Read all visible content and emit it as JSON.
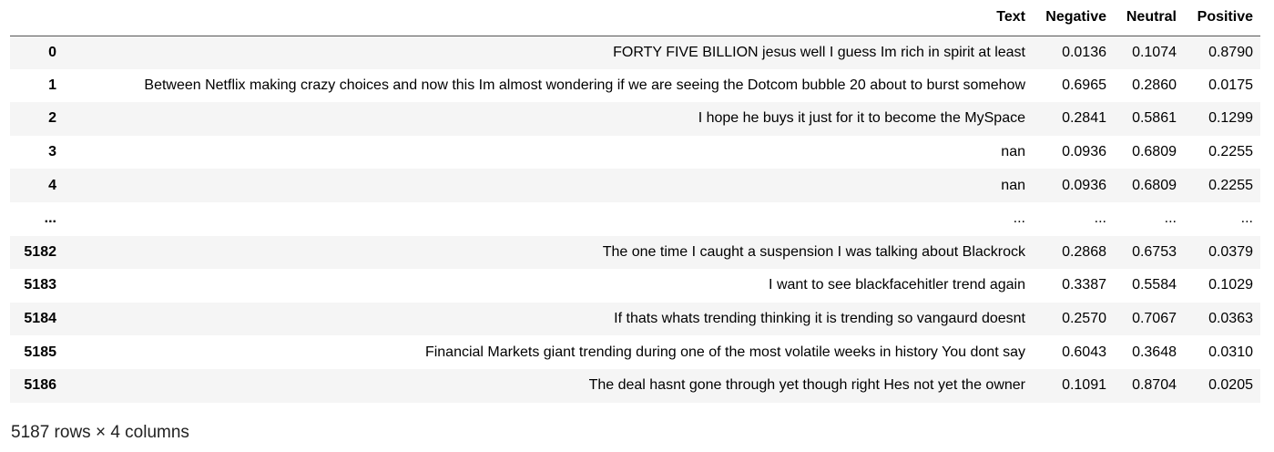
{
  "table": {
    "columns": [
      "Text",
      "Negative",
      "Neutral",
      "Positive"
    ],
    "rows": [
      {
        "index": "0",
        "text": "FORTY FIVE BILLION jesus well I guess Im rich in spirit at least",
        "negative": "0.0136",
        "neutral": "0.1074",
        "positive": "0.8790"
      },
      {
        "index": "1",
        "text": "Between Netflix making crazy choices and now this Im almost wondering if we are seeing the Dotcom bubble 20 about to burst somehow",
        "negative": "0.6965",
        "neutral": "0.2860",
        "positive": "0.0175"
      },
      {
        "index": "2",
        "text": "I hope he buys it just for it to become the MySpace",
        "negative": "0.2841",
        "neutral": "0.5861",
        "positive": "0.1299"
      },
      {
        "index": "3",
        "text": "nan",
        "negative": "0.0936",
        "neutral": "0.6809",
        "positive": "0.2255"
      },
      {
        "index": "4",
        "text": "nan",
        "negative": "0.0936",
        "neutral": "0.6809",
        "positive": "0.2255"
      },
      {
        "index": "...",
        "text": "...",
        "negative": "...",
        "neutral": "...",
        "positive": "..."
      },
      {
        "index": "5182",
        "text": "The one time I caught a suspension I was talking about Blackrock",
        "negative": "0.2868",
        "neutral": "0.6753",
        "positive": "0.0379"
      },
      {
        "index": "5183",
        "text": "I want to see blackfacehitler trend again",
        "negative": "0.3387",
        "neutral": "0.5584",
        "positive": "0.1029"
      },
      {
        "index": "5184",
        "text": "If thats whats trending thinking it is trending so vangaurd doesnt",
        "negative": "0.2570",
        "neutral": "0.7067",
        "positive": "0.0363"
      },
      {
        "index": "5185",
        "text": "Financial Markets giant trending during one of the most volatile weeks in history You dont say",
        "negative": "0.6043",
        "neutral": "0.3648",
        "positive": "0.0310"
      },
      {
        "index": "5186",
        "text": "The deal hasnt gone through yet though right Hes not yet the owner",
        "negative": "0.1091",
        "neutral": "0.8704",
        "positive": "0.0205"
      }
    ]
  },
  "shape_note": "5187 rows × 4 columns",
  "colors": {
    "row_stripe": "#f5f5f5",
    "header_rule": "#555555"
  }
}
